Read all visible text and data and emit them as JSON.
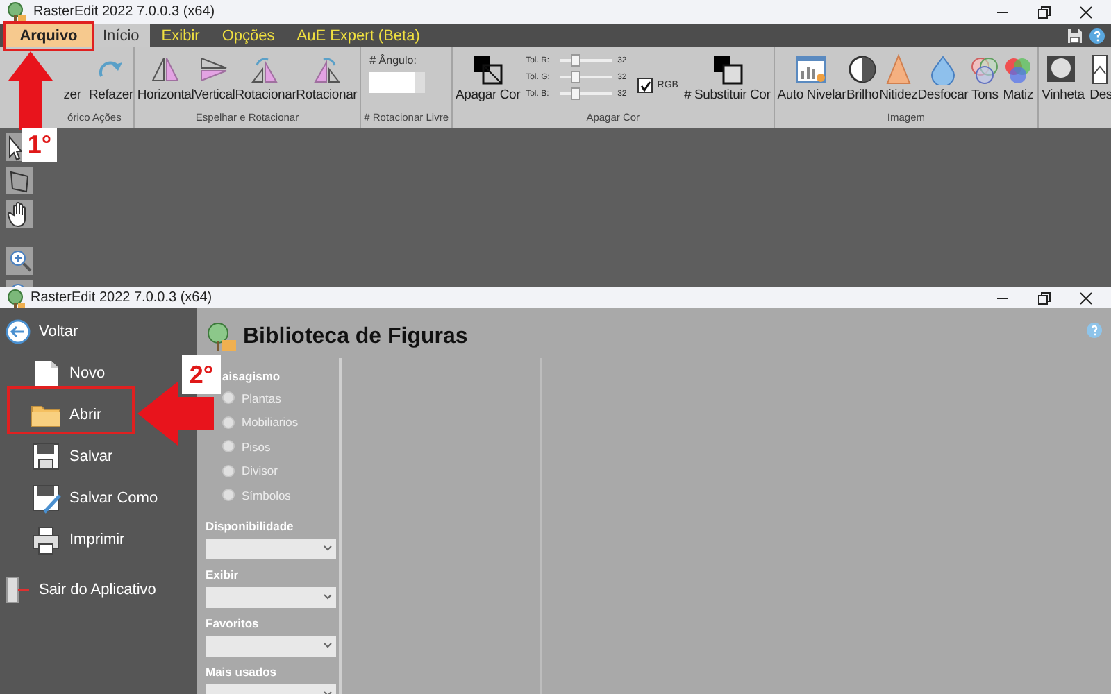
{
  "main_window": {
    "title": "RasterEdit 2022 7.0.0.3 (x64)",
    "tabs": [
      {
        "label": "Arquivo",
        "kind": "file",
        "selected": false
      },
      {
        "label": "Início",
        "kind": "tab",
        "selected": true
      },
      {
        "label": "Exibir",
        "kind": "tab",
        "selected": false
      },
      {
        "label": "Opções",
        "kind": "tab",
        "selected": false
      },
      {
        "label": "AuE Expert (Beta)",
        "kind": "tab",
        "selected": false
      }
    ],
    "ribbon": [
      {
        "title": "órico Ações",
        "items": [
          {
            "kind": "button",
            "label": "zer"
          },
          {
            "kind": "button",
            "label": "Refazer"
          }
        ]
      },
      {
        "title": "Espelhar e Rotacionar",
        "items": [
          {
            "kind": "button",
            "label": "Horizontal"
          },
          {
            "kind": "button",
            "label": "Vertical"
          },
          {
            "kind": "button",
            "label": "Rotacionar"
          },
          {
            "kind": "button",
            "label": "Rotacionar"
          }
        ]
      },
      {
        "title": "# Rotacionar Livre",
        "items": [
          {
            "kind": "field",
            "label": "# Ângulo:"
          }
        ]
      },
      {
        "title": "Apagar Cor",
        "items": [
          {
            "kind": "button",
            "label": "Apagar Cor"
          },
          {
            "kind": "sliders",
            "sliders": [
              {
                "label": "Tol. R:",
                "level": 0.3,
                "reading": "32"
              },
              {
                "label": "Tol. G:",
                "level": 0.3,
                "reading": "32"
              },
              {
                "label": "Tol. B:",
                "level": 0.3,
                "reading": "32"
              }
            ]
          },
          {
            "kind": "checkbox",
            "label": "RGB",
            "checked": true
          },
          {
            "kind": "button",
            "label": "# Substituir Cor"
          }
        ]
      },
      {
        "title": "Imagem",
        "items": [
          {
            "kind": "button",
            "label": "Auto Nivelar"
          },
          {
            "kind": "button",
            "label": "Brilho"
          },
          {
            "kind": "button",
            "label": "Nitidez"
          },
          {
            "kind": "button",
            "label": "Desfocar"
          },
          {
            "kind": "button",
            "label": "Tons"
          },
          {
            "kind": "button",
            "label": "Matiz"
          }
        ]
      },
      {
        "items": [
          {
            "kind": "button",
            "label": "Vinheta"
          },
          {
            "kind": "button",
            "label": "Des"
          }
        ]
      }
    ]
  },
  "library_window": {
    "title": "RasterEdit 2022 7.0.0.3 (x64)",
    "menu": [
      {
        "kind": "back",
        "label": "Voltar"
      },
      {
        "kind": "command",
        "label": "Novo"
      },
      {
        "kind": "command",
        "label": "Abrir"
      },
      {
        "kind": "command",
        "label": "Salvar"
      },
      {
        "kind": "command",
        "label": "Salvar Como"
      },
      {
        "kind": "command",
        "label": "Imprimir"
      },
      {
        "kind": "exit",
        "label": "Sair do Aplicativo"
      }
    ],
    "heading": "Biblioteca de Figuras",
    "section": "aisagismo",
    "options": [
      {
        "label": "Plantas",
        "selected": false
      },
      {
        "label": "Mobiliarios",
        "selected": false
      },
      {
        "label": "Pisos",
        "selected": false
      },
      {
        "label": "Divisor",
        "selected": false
      },
      {
        "label": "Símbolos",
        "selected": false
      }
    ],
    "filters": [
      {
        "label": "Disponibilidade"
      },
      {
        "label": "Exibir"
      },
      {
        "label": "Favoritos"
      },
      {
        "label": "Mais usados"
      }
    ]
  },
  "annotations": [
    {
      "label": "1°"
    },
    {
      "label": "2°"
    }
  ]
}
